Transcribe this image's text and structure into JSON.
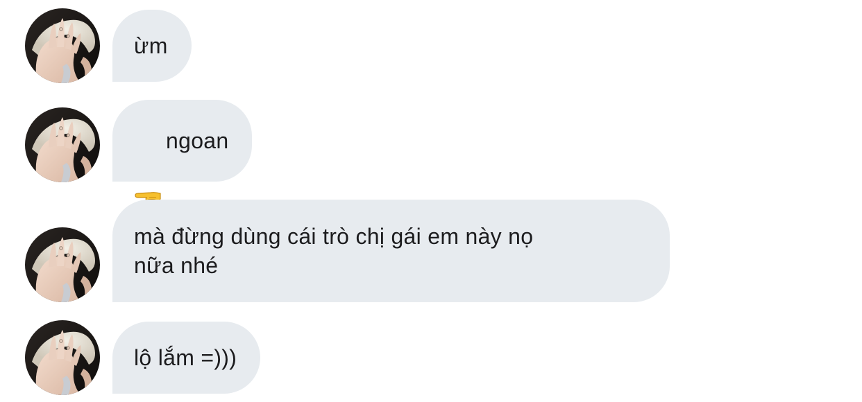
{
  "chat": {
    "messages": [
      {
        "text": "ừm",
        "emoji": null
      },
      {
        "text": "ngoan",
        "emoji": "backhand-pointing-left-icon"
      },
      {
        "text": "mà đừng dùng cái trò chị gái em này nọ\nnữa nhé",
        "emoji": null
      },
      {
        "text": "lộ lắm =)))",
        "emoji": null
      }
    ]
  },
  "colors": {
    "bubble_bg": "#e7ebef",
    "text": "#1c1c1e",
    "background": "#ffffff"
  }
}
